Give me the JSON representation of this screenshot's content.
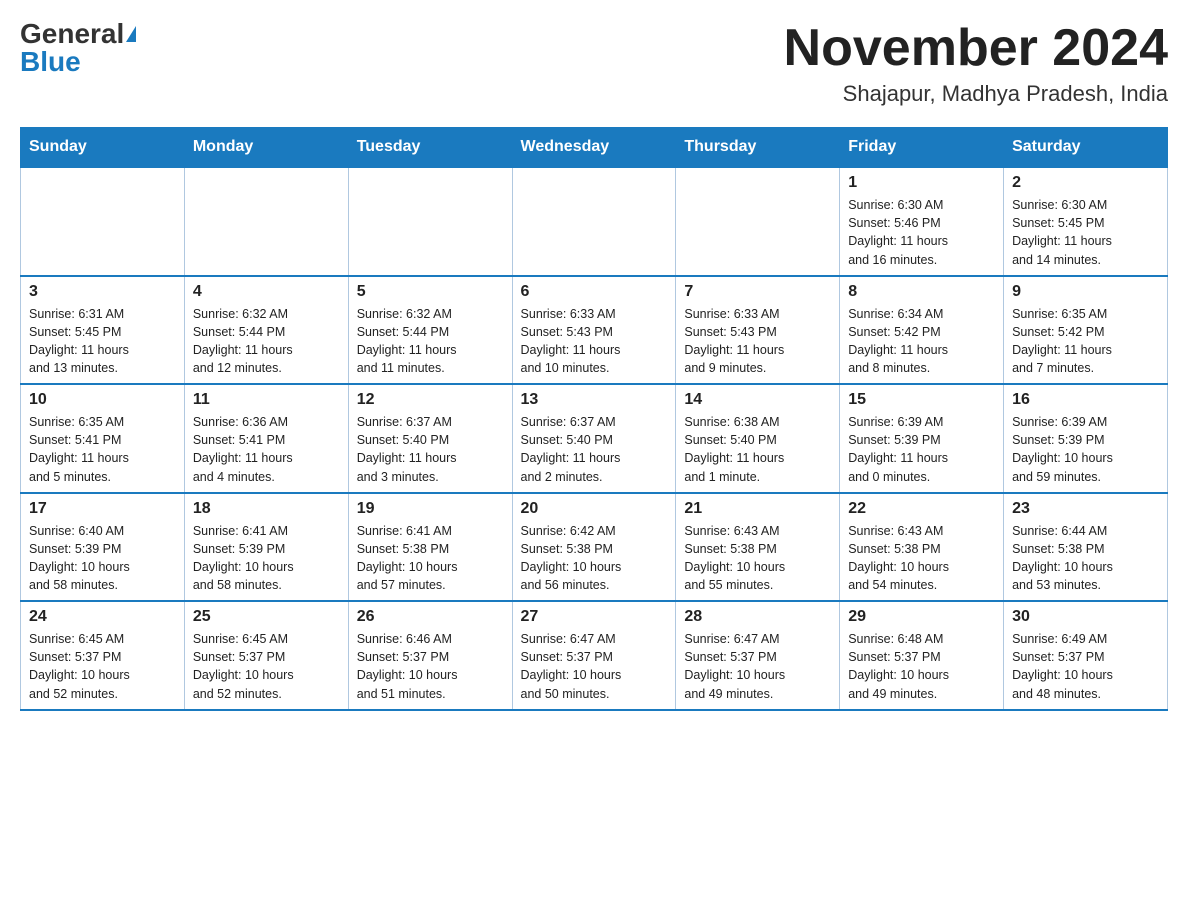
{
  "header": {
    "logo_general": "General",
    "logo_blue": "Blue",
    "month_title": "November 2024",
    "location": "Shajapur, Madhya Pradesh, India"
  },
  "days_of_week": [
    "Sunday",
    "Monday",
    "Tuesday",
    "Wednesday",
    "Thursday",
    "Friday",
    "Saturday"
  ],
  "weeks": [
    [
      {
        "day": "",
        "info": ""
      },
      {
        "day": "",
        "info": ""
      },
      {
        "day": "",
        "info": ""
      },
      {
        "day": "",
        "info": ""
      },
      {
        "day": "",
        "info": ""
      },
      {
        "day": "1",
        "info": "Sunrise: 6:30 AM\nSunset: 5:46 PM\nDaylight: 11 hours\nand 16 minutes."
      },
      {
        "day": "2",
        "info": "Sunrise: 6:30 AM\nSunset: 5:45 PM\nDaylight: 11 hours\nand 14 minutes."
      }
    ],
    [
      {
        "day": "3",
        "info": "Sunrise: 6:31 AM\nSunset: 5:45 PM\nDaylight: 11 hours\nand 13 minutes."
      },
      {
        "day": "4",
        "info": "Sunrise: 6:32 AM\nSunset: 5:44 PM\nDaylight: 11 hours\nand 12 minutes."
      },
      {
        "day": "5",
        "info": "Sunrise: 6:32 AM\nSunset: 5:44 PM\nDaylight: 11 hours\nand 11 minutes."
      },
      {
        "day": "6",
        "info": "Sunrise: 6:33 AM\nSunset: 5:43 PM\nDaylight: 11 hours\nand 10 minutes."
      },
      {
        "day": "7",
        "info": "Sunrise: 6:33 AM\nSunset: 5:43 PM\nDaylight: 11 hours\nand 9 minutes."
      },
      {
        "day": "8",
        "info": "Sunrise: 6:34 AM\nSunset: 5:42 PM\nDaylight: 11 hours\nand 8 minutes."
      },
      {
        "day": "9",
        "info": "Sunrise: 6:35 AM\nSunset: 5:42 PM\nDaylight: 11 hours\nand 7 minutes."
      }
    ],
    [
      {
        "day": "10",
        "info": "Sunrise: 6:35 AM\nSunset: 5:41 PM\nDaylight: 11 hours\nand 5 minutes."
      },
      {
        "day": "11",
        "info": "Sunrise: 6:36 AM\nSunset: 5:41 PM\nDaylight: 11 hours\nand 4 minutes."
      },
      {
        "day": "12",
        "info": "Sunrise: 6:37 AM\nSunset: 5:40 PM\nDaylight: 11 hours\nand 3 minutes."
      },
      {
        "day": "13",
        "info": "Sunrise: 6:37 AM\nSunset: 5:40 PM\nDaylight: 11 hours\nand 2 minutes."
      },
      {
        "day": "14",
        "info": "Sunrise: 6:38 AM\nSunset: 5:40 PM\nDaylight: 11 hours\nand 1 minute."
      },
      {
        "day": "15",
        "info": "Sunrise: 6:39 AM\nSunset: 5:39 PM\nDaylight: 11 hours\nand 0 minutes."
      },
      {
        "day": "16",
        "info": "Sunrise: 6:39 AM\nSunset: 5:39 PM\nDaylight: 10 hours\nand 59 minutes."
      }
    ],
    [
      {
        "day": "17",
        "info": "Sunrise: 6:40 AM\nSunset: 5:39 PM\nDaylight: 10 hours\nand 58 minutes."
      },
      {
        "day": "18",
        "info": "Sunrise: 6:41 AM\nSunset: 5:39 PM\nDaylight: 10 hours\nand 58 minutes."
      },
      {
        "day": "19",
        "info": "Sunrise: 6:41 AM\nSunset: 5:38 PM\nDaylight: 10 hours\nand 57 minutes."
      },
      {
        "day": "20",
        "info": "Sunrise: 6:42 AM\nSunset: 5:38 PM\nDaylight: 10 hours\nand 56 minutes."
      },
      {
        "day": "21",
        "info": "Sunrise: 6:43 AM\nSunset: 5:38 PM\nDaylight: 10 hours\nand 55 minutes."
      },
      {
        "day": "22",
        "info": "Sunrise: 6:43 AM\nSunset: 5:38 PM\nDaylight: 10 hours\nand 54 minutes."
      },
      {
        "day": "23",
        "info": "Sunrise: 6:44 AM\nSunset: 5:38 PM\nDaylight: 10 hours\nand 53 minutes."
      }
    ],
    [
      {
        "day": "24",
        "info": "Sunrise: 6:45 AM\nSunset: 5:37 PM\nDaylight: 10 hours\nand 52 minutes."
      },
      {
        "day": "25",
        "info": "Sunrise: 6:45 AM\nSunset: 5:37 PM\nDaylight: 10 hours\nand 52 minutes."
      },
      {
        "day": "26",
        "info": "Sunrise: 6:46 AM\nSunset: 5:37 PM\nDaylight: 10 hours\nand 51 minutes."
      },
      {
        "day": "27",
        "info": "Sunrise: 6:47 AM\nSunset: 5:37 PM\nDaylight: 10 hours\nand 50 minutes."
      },
      {
        "day": "28",
        "info": "Sunrise: 6:47 AM\nSunset: 5:37 PM\nDaylight: 10 hours\nand 49 minutes."
      },
      {
        "day": "29",
        "info": "Sunrise: 6:48 AM\nSunset: 5:37 PM\nDaylight: 10 hours\nand 49 minutes."
      },
      {
        "day": "30",
        "info": "Sunrise: 6:49 AM\nSunset: 5:37 PM\nDaylight: 10 hours\nand 48 minutes."
      }
    ]
  ]
}
